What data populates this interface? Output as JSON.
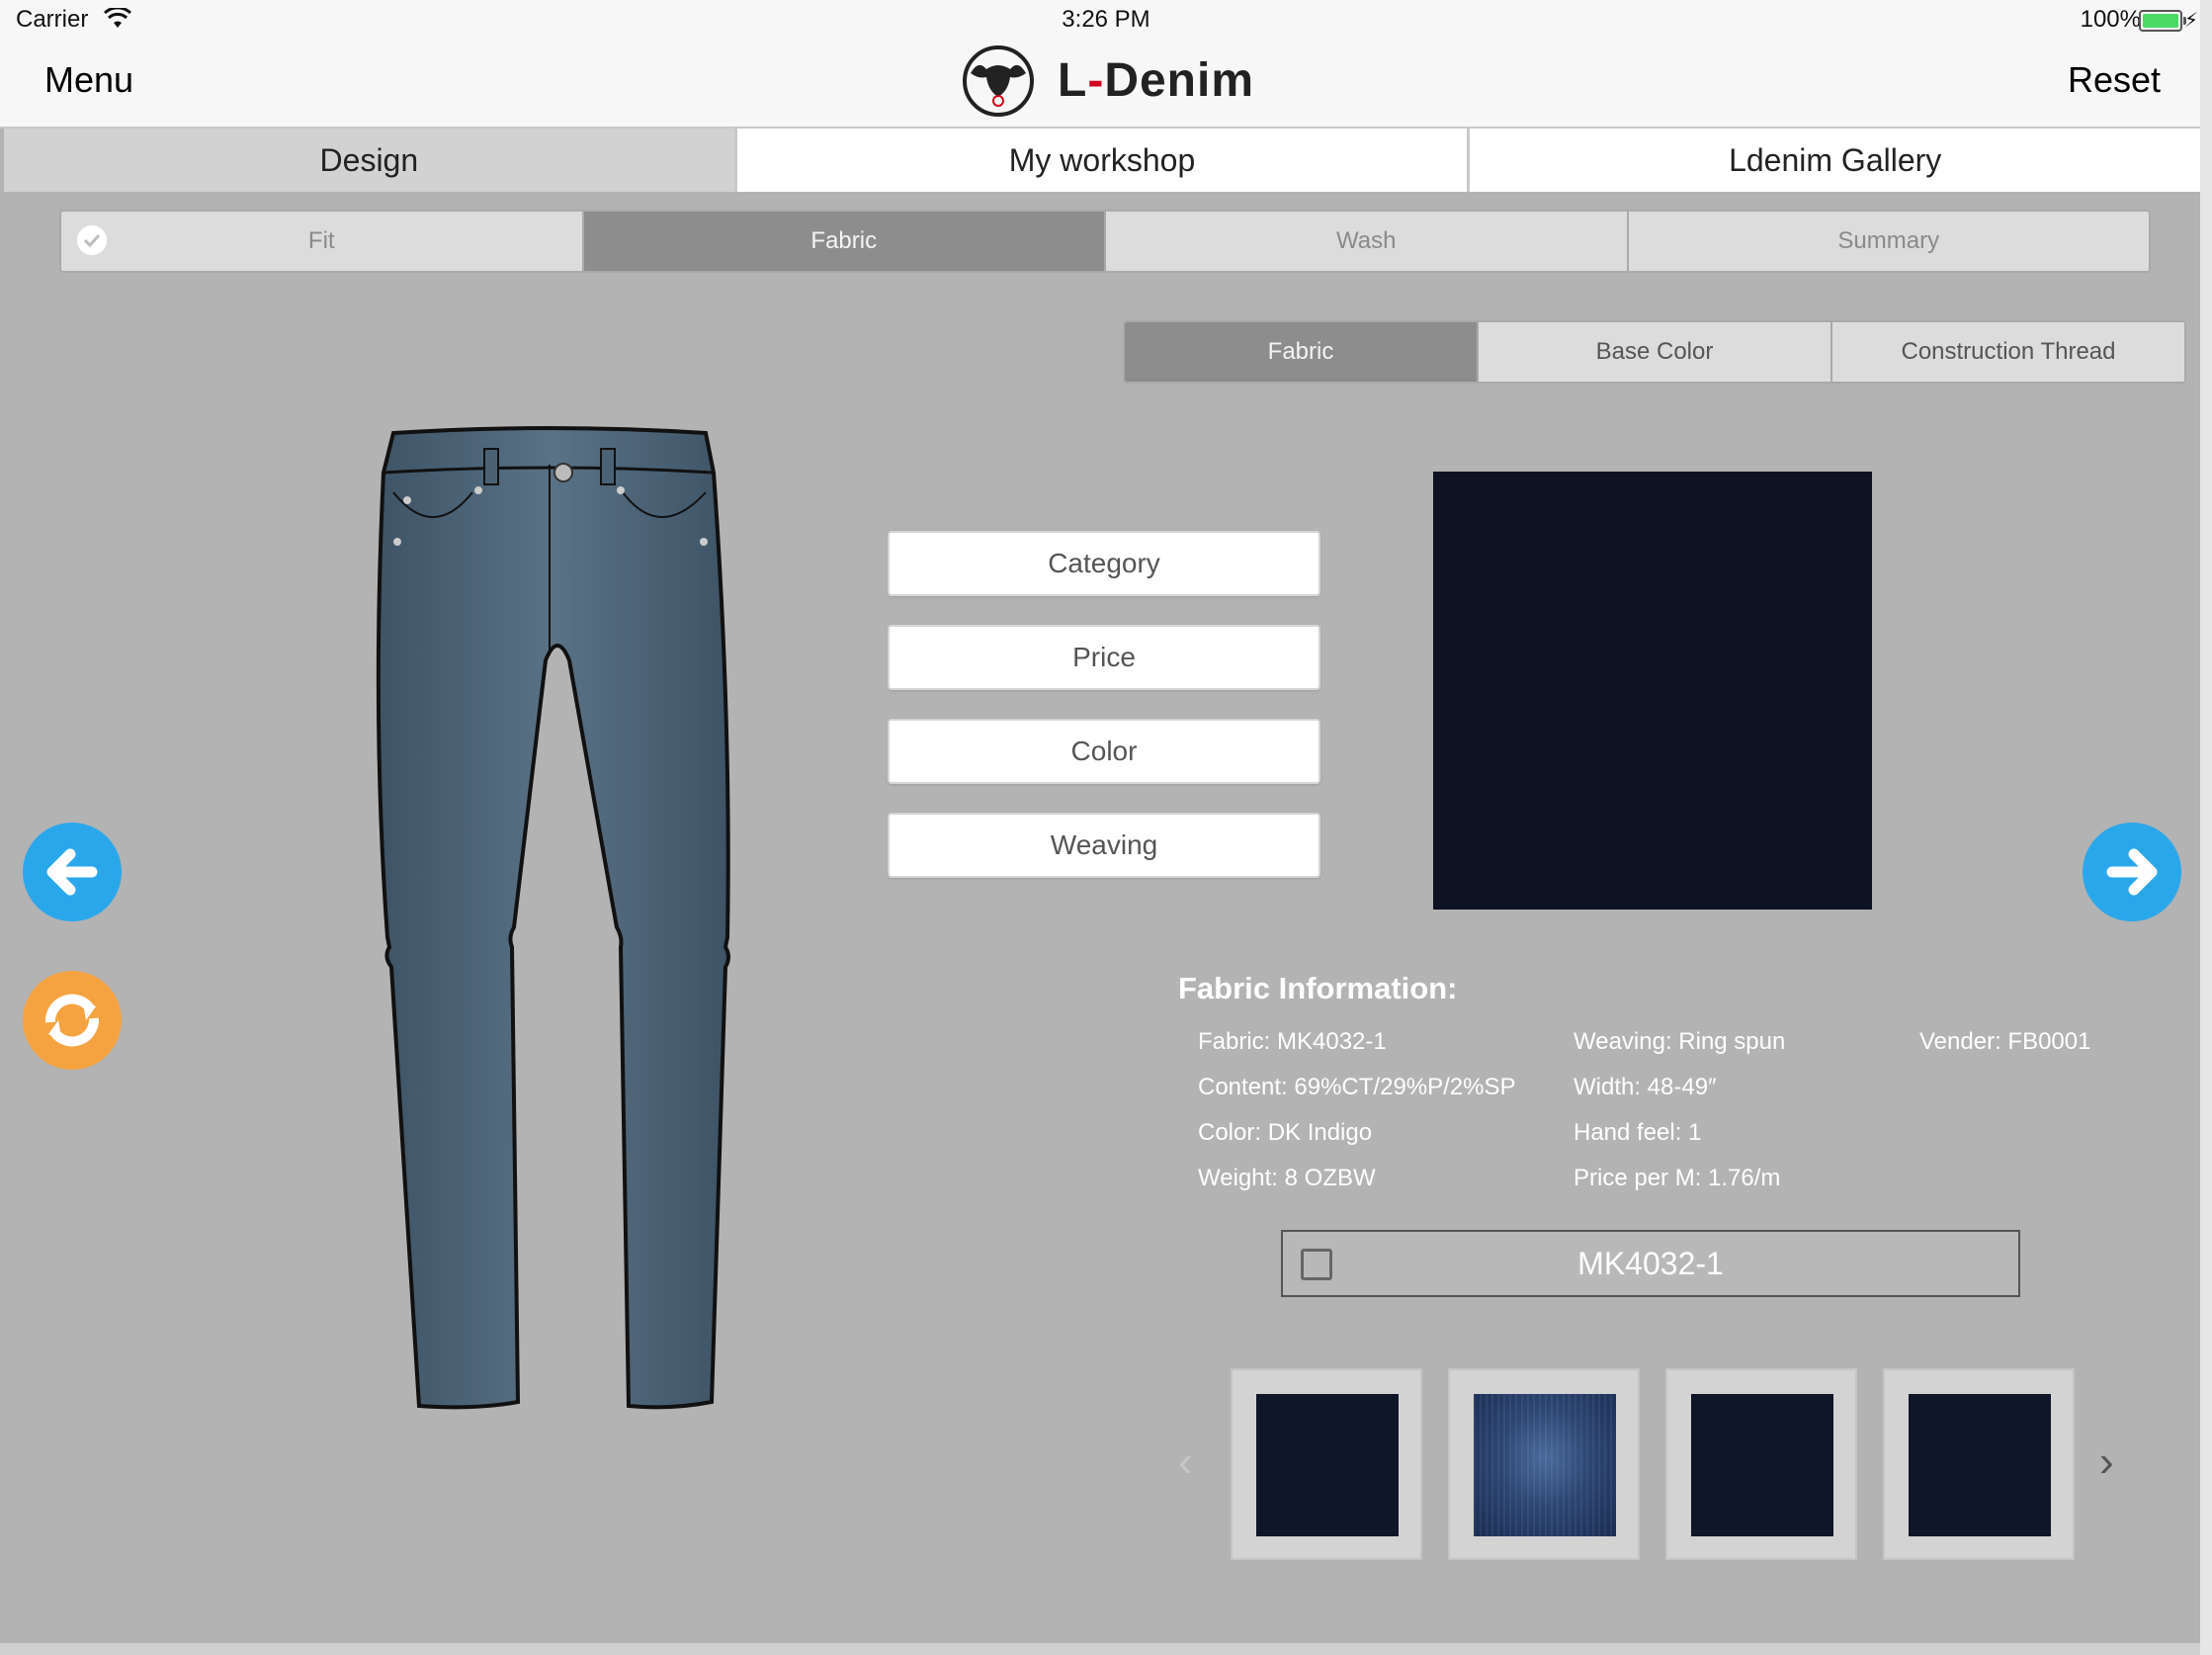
{
  "status_bar": {
    "carrier": "Carrier",
    "time": "3:26 PM",
    "battery": "100%"
  },
  "nav": {
    "menu_label": "Menu",
    "brand_prefix": "L",
    "brand_dash": "-",
    "brand_name": "Denim",
    "reset_label": "Reset"
  },
  "main_tabs": [
    {
      "label": "Design",
      "active": true
    },
    {
      "label": "My workshop",
      "active": false
    },
    {
      "label": "Ldenim Gallery",
      "active": false
    }
  ],
  "steps": [
    {
      "label": "Fit",
      "completed": true
    },
    {
      "label": "Fabric",
      "active": true
    },
    {
      "label": "Wash"
    },
    {
      "label": "Summary"
    }
  ],
  "sub_tabs": [
    {
      "label": "Fabric",
      "active": true
    },
    {
      "label": "Base Color"
    },
    {
      "label": "Construction Thread"
    }
  ],
  "filters": [
    "Category",
    "Price",
    "Color",
    "Weaving"
  ],
  "fabric_info": {
    "title": "Fabric Information:",
    "fabric": "Fabric: MK4032-1",
    "content": "Content: 69%CT/29%P/2%SP",
    "color": "Color: DK Indigo",
    "weight": "Weight: 8 OZBW",
    "weaving": "Weaving: Ring spun",
    "width": "Width: 48-49″",
    "hand_feel": "Hand feel: 1",
    "price": "Price per M: 1.76/m",
    "vender": "Vender: FB0001"
  },
  "selection": {
    "label": "MK4032-1",
    "checked": false
  },
  "swatch_color": "#0d1322",
  "thumbnails": [
    {
      "style": "dark"
    },
    {
      "style": "washed"
    },
    {
      "style": "dark"
    },
    {
      "style": "dark"
    }
  ],
  "colors": {
    "accent_blue": "#2aa7eb",
    "accent_orange": "#f5a340",
    "segment_active": "#8d8d8d",
    "brand_dash": "#d0021b"
  },
  "icons": {
    "wifi": "wifi-icon",
    "battery": "battery-icon",
    "logo": "bull-logo-icon",
    "prev": "arrow-left-icon",
    "next": "arrow-right-icon",
    "refresh": "refresh-icon",
    "check": "checkmark-icon",
    "carousel_prev": "chevron-left-icon",
    "carousel_next": "chevron-right-icon"
  }
}
